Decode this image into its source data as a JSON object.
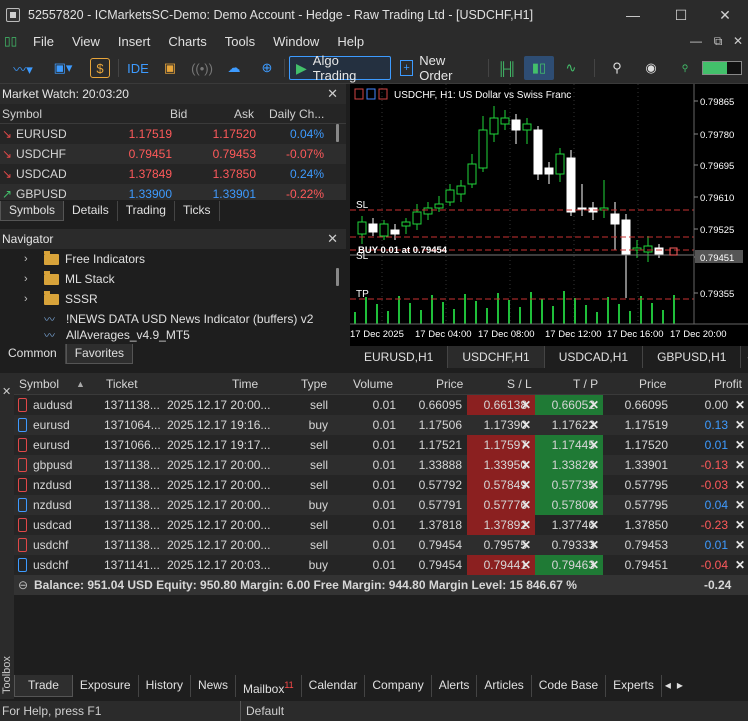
{
  "window": {
    "title": "52557820 - ICMarketsSC-Demo: Demo Account - Hedge - Raw Trading Ltd - [USDCHF,H1]",
    "controls": [
      "—",
      "☐",
      "✕"
    ]
  },
  "menu": [
    "File",
    "View",
    "Insert",
    "Charts",
    "Tools",
    "Window",
    "Help"
  ],
  "toolbar": {
    "ide_label": "IDE",
    "algo_label": "Algo Trading",
    "new_order_label": "New Order"
  },
  "market_watch": {
    "title": "Market Watch: 20:03:20",
    "columns": [
      "Symbol",
      "Bid",
      "Ask",
      "Daily Ch..."
    ],
    "rows": [
      {
        "arrow": "↘",
        "symbol": "EURUSD",
        "bid": "1.17519",
        "ask": "1.17520",
        "change": "0.04%",
        "dir": "down",
        "chg_color": "blue"
      },
      {
        "arrow": "↘",
        "symbol": "USDCHF",
        "bid": "0.79451",
        "ask": "0.79453",
        "change": "-0.07%",
        "dir": "down",
        "chg_color": "red"
      },
      {
        "arrow": "↘",
        "symbol": "USDCAD",
        "bid": "1.37849",
        "ask": "1.37850",
        "change": "0.24%",
        "dir": "down",
        "chg_color": "blue"
      },
      {
        "arrow": "↗",
        "symbol": "GBPUSD",
        "bid": "1.33900",
        "ask": "1.33901",
        "change": "-0.22%",
        "dir": "up",
        "chg_color": "red"
      }
    ],
    "tabs": [
      "Symbols",
      "Details",
      "Trading",
      "Ticks"
    ]
  },
  "navigator": {
    "title": "Navigator",
    "items": [
      "Free Indicators",
      "ML Stack",
      "SSSR",
      "!NEWS DATA USD News Indicator (buffers) v2",
      "AllAverages_v4.9_MT5"
    ],
    "tabs": [
      "Common",
      "Favorites"
    ]
  },
  "chart": {
    "header": "USDCHF, H1:  US Dollar vs Swiss Franc",
    "price_labels": [
      "0.79865",
      "0.79780",
      "0.79695",
      "0.79610",
      "0.79525",
      "0.79451",
      "0.79355"
    ],
    "time_labels": [
      "17 Dec 2025",
      "17 Dec 04:00",
      "17 Dec 08:00",
      "17 Dec 12:00",
      "17 Dec 16:00",
      "17 Dec 20:00"
    ],
    "order_label": "BUY 0.01 at 0.79454",
    "sl_label": "SL",
    "tp_label": "TP",
    "tabs": [
      "EURUSD,H1",
      "USDCHF,H1",
      "USDCAD,H1",
      "GBPUSD,H1"
    ]
  },
  "trade": {
    "columns": [
      "Symbol",
      "Ticket",
      "Time",
      "Type",
      "Volume",
      "Price",
      "S / L",
      "T / P",
      "Price",
      "Profit"
    ],
    "rows": [
      {
        "symbol": "audusd",
        "ticket": "1371138...",
        "time": "2025.12.17 20:00...",
        "type": "sell",
        "volume": "0.01",
        "price": "0.66095",
        "sl": "0.66138",
        "tp": "0.66052",
        "cur": "0.66095",
        "profit": "0.00",
        "sl_hl": "sl",
        "tp_hl": "tp",
        "pcolor": "neutral"
      },
      {
        "symbol": "eurusd",
        "ticket": "1371064...",
        "time": "2025.12.17 19:16...",
        "type": "buy",
        "volume": "0.01",
        "price": "1.17506",
        "sl": "1.17390",
        "tp": "1.17622",
        "cur": "1.17519",
        "profit": "0.13",
        "sl_hl": "",
        "tp_hl": "",
        "pcolor": "blue"
      },
      {
        "symbol": "eurusd",
        "ticket": "1371066...",
        "time": "2025.12.17 19:17...",
        "type": "sell",
        "volume": "0.01",
        "price": "1.17521",
        "sl": "1.17597",
        "tp": "1.17445",
        "cur": "1.17520",
        "profit": "0.01",
        "sl_hl": "sl",
        "tp_hl": "tp",
        "pcolor": "blue"
      },
      {
        "symbol": "gbpusd",
        "ticket": "1371138...",
        "time": "2025.12.17 20:00...",
        "type": "sell",
        "volume": "0.01",
        "price": "1.33888",
        "sl": "1.33950",
        "tp": "1.33826",
        "cur": "1.33901",
        "profit": "-0.13",
        "sl_hl": "sl",
        "tp_hl": "tp",
        "pcolor": "red"
      },
      {
        "symbol": "nzdusd",
        "ticket": "1371138...",
        "time": "2025.12.17 20:00...",
        "type": "sell",
        "volume": "0.01",
        "price": "0.57792",
        "sl": "0.57849",
        "tp": "0.57735",
        "cur": "0.57795",
        "profit": "-0.03",
        "sl_hl": "sl",
        "tp_hl": "tp",
        "pcolor": "red"
      },
      {
        "symbol": "nzdusd",
        "ticket": "1371138...",
        "time": "2025.12.17 20:00...",
        "type": "buy",
        "volume": "0.01",
        "price": "0.57791",
        "sl": "0.57776",
        "tp": "0.57806",
        "cur": "0.57795",
        "profit": "0.04",
        "sl_hl": "sl",
        "tp_hl": "tp",
        "pcolor": "blue"
      },
      {
        "symbol": "usdcad",
        "ticket": "1371138...",
        "time": "2025.12.17 20:00...",
        "type": "sell",
        "volume": "0.01",
        "price": "1.37818",
        "sl": "1.37892",
        "tp": "1.37746",
        "cur": "1.37850",
        "profit": "-0.23",
        "sl_hl": "sl",
        "tp_hl": "",
        "pcolor": "red"
      },
      {
        "symbol": "usdchf",
        "ticket": "1371138...",
        "time": "2025.12.17 20:00...",
        "type": "sell",
        "volume": "0.01",
        "price": "0.79454",
        "sl": "0.79575",
        "tp": "0.79333",
        "cur": "0.79453",
        "profit": "0.01",
        "sl_hl": "",
        "tp_hl": "",
        "pcolor": "blue"
      },
      {
        "symbol": "usdchf",
        "ticket": "1371141...",
        "time": "2025.12.17 20:03...",
        "type": "buy",
        "volume": "0.01",
        "price": "0.79454",
        "sl": "0.79441",
        "tp": "0.79463",
        "cur": "0.79451",
        "profit": "-0.04",
        "sl_hl": "sl",
        "tp_hl": "tp",
        "pcolor": "red"
      }
    ],
    "balance_text": "Balance: 951.04 USD  Equity: 950.80  Margin: 6.00  Free Margin: 944.80  Margin Level: 15 846.67 %",
    "total_profit": "-0.24"
  },
  "bottom_tabs": [
    "Trade",
    "Exposure",
    "History",
    "News",
    "Mailbox",
    "Calendar",
    "Company",
    "Alerts",
    "Articles",
    "Code Base",
    "Experts"
  ],
  "mailbox_count": "11",
  "toolbox_label": "Toolbox",
  "status": {
    "help": "For Help, press F1",
    "profile": "Default"
  }
}
